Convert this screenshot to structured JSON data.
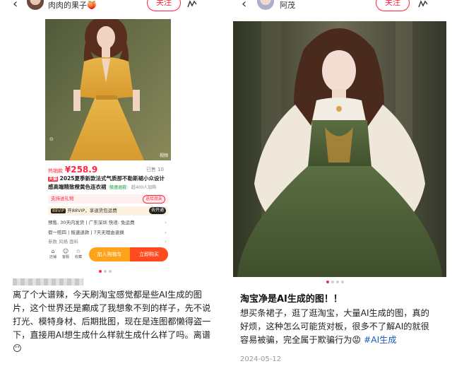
{
  "left_post": {
    "header": {
      "username": "肉肉的果子🍑",
      "follow_label": "关注",
      "share_icon": "share-icon"
    },
    "product": {
      "hot_label": "热销款",
      "price": "¥258.9",
      "sold": "已售 10",
      "store_badge": "天猫",
      "title": "2025夏季新款法式气质那不勒斯裙小众设计感高端精致橙黄色连衣裙",
      "chip_return": "极速退款",
      "chip_popular": "超400人加购",
      "gift_text": "支持送礼物",
      "gift_action": "送给朋友",
      "vip_badge": "88VIP",
      "vip_text": "开88VIP，享退货包运费",
      "vip_action": "去开通",
      "delivery_text": "预售, 30天内发货 | 广东深圳 快递: 免运费",
      "service_text": "假一赔四 | 极速退款 | 7天无理由退换",
      "params_text": "参数 风格 面料",
      "video_label": "视频",
      "bottom_icons": [
        {
          "label": "店铺",
          "icon": "store-icon"
        },
        {
          "label": "客服",
          "icon": "service-icon"
        },
        {
          "label": "收藏",
          "icon": "star-icon"
        }
      ],
      "add_cart_label": "加入购物车",
      "buy_now_label": "立即购买"
    },
    "text": "离了个大谱辣，今天刷淘宝感觉都是些AI生成的图片，这个世界还是癫成了我想象不到的样子，先不说打光、模特身材、后期批图，现在是连图都懒得盗一下，直接用AI想生成什么样就生成什么样了吗。离谱😶"
  },
  "right_post": {
    "header": {
      "username": "阿茂",
      "follow_label": "关注",
      "share_icon": "share-icon"
    },
    "title": "淘宝净是AI生成的图！！",
    "text": "想买条裙子，逛了逛淘宝，大量AI生成的图，真的好烦，这种怎么可能货对板，很多不了解AI的就很容易被骗，完全属于欺骗行为😡",
    "hashtag": "#AI生成",
    "date": "2024-05-12"
  },
  "colors": {
    "accent": "#ff2442",
    "hashtag": "#1d5bbf",
    "cart": "#ffa31a",
    "buy": "#ff4b1f"
  }
}
